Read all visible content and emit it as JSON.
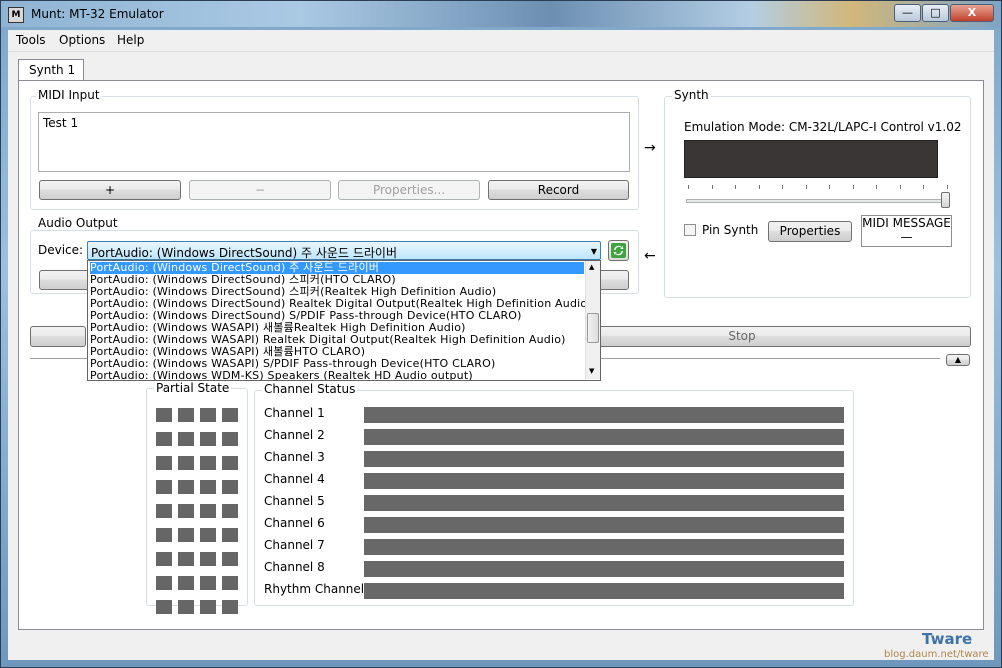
{
  "window": {
    "title": "Munt: MT-32 Emulator",
    "icon_label": "M",
    "controls": {
      "minimize": "—",
      "maximize": "□",
      "close": "X"
    }
  },
  "menu": [
    "Tools",
    "Options",
    "Help"
  ],
  "tab": {
    "label": "Synth 1"
  },
  "midi_input": {
    "title": "MIDI Input",
    "list_item": "Test 1",
    "buttons": {
      "add": "+",
      "remove": "−",
      "properties": "Properties...",
      "record": "Record"
    }
  },
  "synth": {
    "title": "Synth",
    "emulation_mode": "Emulation Mode: CM-32L/LAPC-I Control v1.02",
    "pin_synth_label": "Pin Synth",
    "pin_synth_checked": false,
    "properties_button": "Properties",
    "midi_message_label": "MIDI MESSAGE",
    "midi_message_value": "—",
    "slider_level": 1.0
  },
  "arrows": {
    "right": "→",
    "left": "←"
  },
  "audio_output": {
    "title": "Audio Output",
    "device_label": "Device:",
    "selected_device": "PortAudio: (Windows DirectSound) 주 사운드 드라이버",
    "options": [
      "PortAudio: (Windows DirectSound) 주 사운드 드라이버",
      "PortAudio: (Windows DirectSound) 스피커(HTO CLARO)",
      "PortAudio: (Windows DirectSound) 스피커(Realtek High Definition Audio)",
      "PortAudio: (Windows DirectSound) Realtek Digital Output(Realtek High Definition Audio)",
      "PortAudio: (Windows DirectSound) S/PDIF Pass-through Device(HTO CLARO)",
      "PortAudio: (Windows WASAPI) 새볼륨Realtek High Definition Audio)",
      "PortAudio: (Windows WASAPI) Realtek Digital Output(Realtek High Definition Audio)",
      "PortAudio: (Windows WASAPI) 새볼륨HTO CLARO)",
      "PortAudio: (Windows WASAPI) S/PDIF Pass-through Device(HTO CLARO)",
      "PortAudio: (Windows WDM-KS) Speakers (Realtek HD Audio output)"
    ]
  },
  "stop_button": "Stop",
  "collapse_button": "▲",
  "partial_state": {
    "title": "Partial State",
    "rows": 9,
    "cols": 4
  },
  "channel_status": {
    "title": "Channel Status",
    "channels": [
      "Channel 1",
      "Channel 2",
      "Channel 3",
      "Channel 4",
      "Channel 5",
      "Channel 6",
      "Channel 7",
      "Channel 8",
      "Rhythm Channel"
    ]
  },
  "watermark": {
    "name": "Tware",
    "url": "blog.daum.net/tware"
  }
}
